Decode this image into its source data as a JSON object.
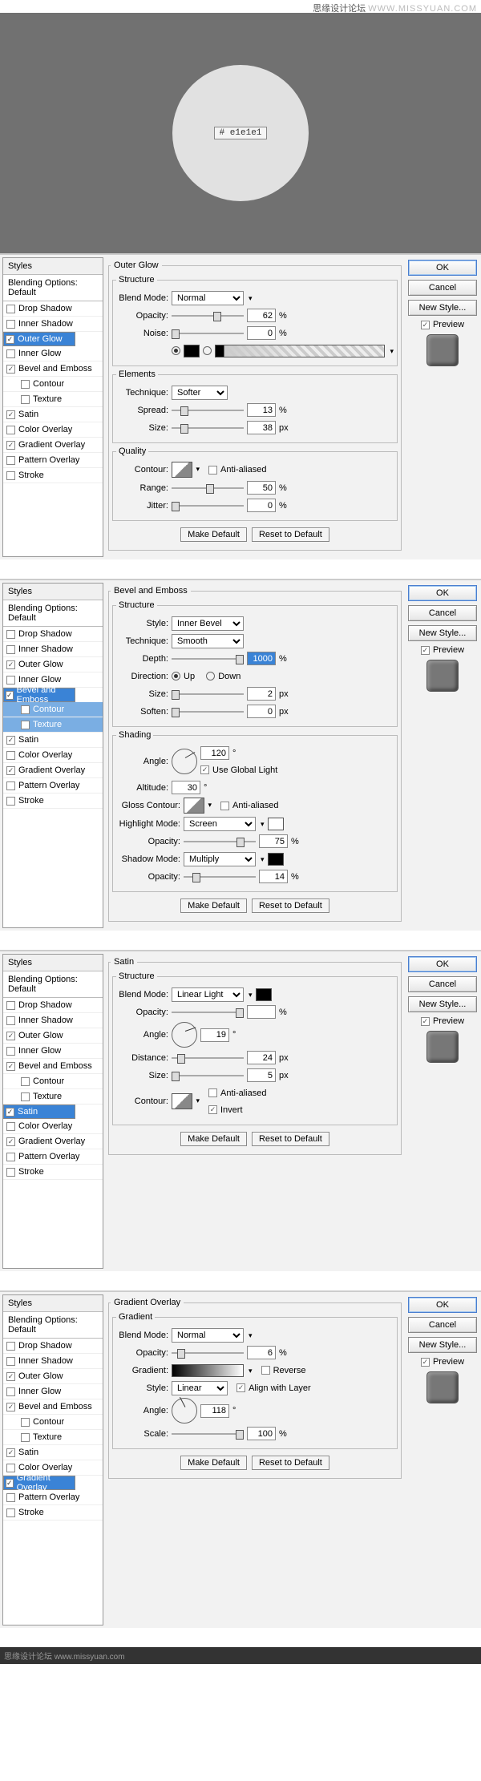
{
  "watermark": {
    "cn": "思缘设计论坛",
    "en": "WWW.MISSYUAN.COM"
  },
  "hex_label": "# e1e1e1",
  "common": {
    "styles_header": "Styles",
    "blending_default": "Blending Options: Default",
    "ok": "OK",
    "cancel": "Cancel",
    "new_style": "New Style...",
    "preview": "Preview",
    "make_default": "Make Default",
    "reset": "Reset to Default"
  },
  "sidebar": {
    "drop_shadow": "Drop Shadow",
    "inner_shadow": "Inner Shadow",
    "outer_glow": "Outer Glow",
    "inner_glow": "Inner Glow",
    "bevel_emboss": "Bevel and Emboss",
    "contour": "Contour",
    "texture": "Texture",
    "satin": "Satin",
    "color_overlay": "Color Overlay",
    "gradient_overlay": "Gradient Overlay",
    "pattern_overlay": "Pattern Overlay",
    "stroke": "Stroke"
  },
  "panels": [
    {
      "id": "outer-glow",
      "title": "Outer Glow",
      "structure": {
        "label": "Structure",
        "blend_mode": "Blend Mode:",
        "blend_val": "Normal",
        "opacity": "Opacity:",
        "opacity_val": "62",
        "opacity_unit": "%",
        "noise": "Noise:",
        "noise_val": "0",
        "noise_unit": "%"
      },
      "elements": {
        "label": "Elements",
        "technique": "Technique:",
        "technique_val": "Softer",
        "spread": "Spread:",
        "spread_val": "13",
        "spread_unit": "%",
        "size": "Size:",
        "size_val": "38",
        "size_unit": "px"
      },
      "quality": {
        "label": "Quality",
        "contour": "Contour:",
        "anti": "Anti-aliased",
        "range": "Range:",
        "range_val": "50",
        "range_unit": "%",
        "jitter": "Jitter:",
        "jitter_val": "0",
        "jitter_unit": "%"
      }
    },
    {
      "id": "bevel",
      "title": "Bevel and Emboss",
      "structure": {
        "label": "Structure",
        "style": "Style:",
        "style_val": "Inner Bevel",
        "technique": "Technique:",
        "technique_val": "Smooth",
        "depth": "Depth:",
        "depth_val": "1000",
        "depth_unit": "%",
        "direction": "Direction:",
        "up": "Up",
        "down": "Down",
        "size": "Size:",
        "size_val": "2",
        "size_unit": "px",
        "soften": "Soften:",
        "soften_val": "0",
        "soften_unit": "px"
      },
      "shading": {
        "label": "Shading",
        "angle": "Angle:",
        "angle_val": "120",
        "deg": "°",
        "global": "Use Global Light",
        "altitude": "Altitude:",
        "altitude_val": "30",
        "gloss": "Gloss Contour:",
        "anti": "Anti-aliased",
        "highlight": "Highlight Mode:",
        "hl_val": "Screen",
        "hl_op": "Opacity:",
        "hl_op_val": "75",
        "hl_op_unit": "%",
        "shadow": "Shadow Mode:",
        "sh_val": "Multiply",
        "sh_op": "Opacity:",
        "sh_op_val": "14",
        "sh_op_unit": "%"
      }
    },
    {
      "id": "satin",
      "title": "Satin",
      "structure": {
        "label": "Structure",
        "blend_mode": "Blend Mode:",
        "blend_val": "Linear Light",
        "opacity": "Opacity:",
        "opacity_val": "",
        "opacity_unit": "%",
        "angle": "Angle:",
        "angle_val": "19",
        "deg": "°",
        "distance": "Distance:",
        "distance_val": "24",
        "dist_unit": "px",
        "size": "Size:",
        "size_val": "5",
        "size_unit": "px",
        "contour": "Contour:",
        "anti": "Anti-aliased",
        "invert": "Invert"
      }
    },
    {
      "id": "gradient",
      "title": "Gradient Overlay",
      "sub": {
        "label": "Gradient",
        "blend_mode": "Blend Mode:",
        "blend_val": "Normal",
        "opacity": "Opacity:",
        "opacity_val": "6",
        "opacity_unit": "%",
        "gradient": "Gradient:",
        "reverse": "Reverse",
        "style": "Style:",
        "style_val": "Linear",
        "align": "Align with Layer",
        "angle": "Angle:",
        "angle_val": "118",
        "deg": "°",
        "scale": "Scale:",
        "scale_val": "100",
        "scale_unit": "%"
      }
    }
  ],
  "footer": "思缘设计论坛 www.missyuan.com"
}
